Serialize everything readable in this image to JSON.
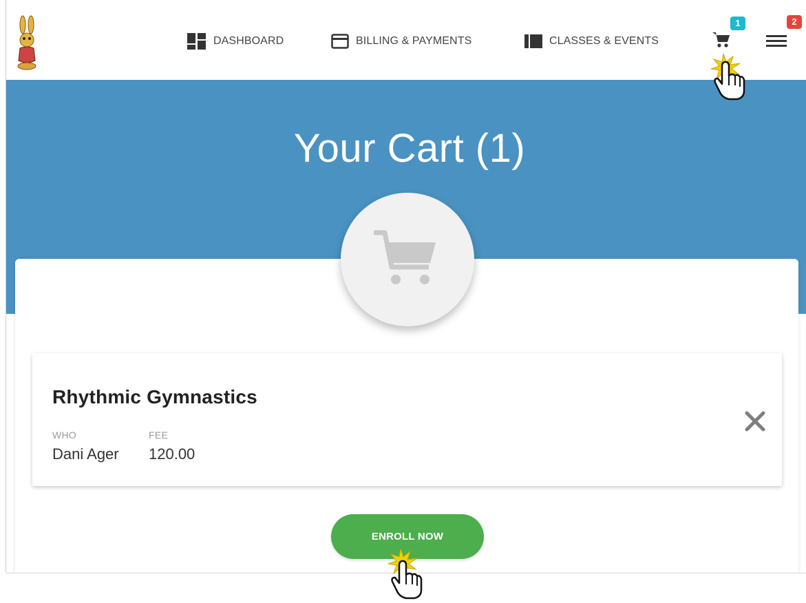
{
  "nav": {
    "dashboard": "DASHBOARD",
    "billing": "BILLING & PAYMENTS",
    "classes": "CLASSES & EVENTS",
    "cart_badge": "1",
    "menu_badge": "2"
  },
  "hero": {
    "title": "Your Cart (1)"
  },
  "cart_item": {
    "name": "Rhythmic Gymnastics",
    "who_label": "WHO",
    "who_value": "Dani Ager",
    "fee_label": "FEE",
    "fee_value": "120.00"
  },
  "actions": {
    "enroll_label": "ENROLL NOW"
  },
  "colors": {
    "hero_blue": "#4a92c2",
    "enroll_green": "#4cae4c",
    "cart_badge": "#1fb8cf",
    "menu_badge": "#e8433a"
  },
  "icons": {
    "logo": "bunny-logo",
    "dashboard": "dashboard-icon",
    "billing": "credit-card-icon",
    "classes": "book-icon",
    "cart": "shopping-cart-icon",
    "menu": "hamburger-menu-icon",
    "remove": "close-icon"
  }
}
